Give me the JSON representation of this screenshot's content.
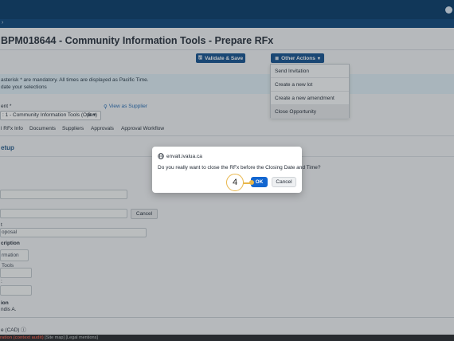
{
  "header": {
    "page_title": "BPM018644 - Community Information Tools - Prepare RFx"
  },
  "toolbar": {
    "validate_label": "Validate & Save",
    "other_actions_label": "Other Actions"
  },
  "actions_menu": {
    "items": [
      "Send Invitation",
      "Create a new lot",
      "Create a new amendment",
      "Close Opportunity"
    ],
    "highlighted": "Close Opportunity"
  },
  "banner": {
    "line1": "asterisk * are mandatory. All times are displayed as Pacific Time.",
    "line2": "date your selections"
  },
  "document": {
    "label": "ent *",
    "selected": ": 1 - Community Information Tools (Open)",
    "view_supplier": "View as Supplier"
  },
  "tabs": [
    "l RFx Info",
    "Documents",
    "Suppliers",
    "Approvals",
    "Approval Workflow"
  ],
  "section": {
    "title": "etup"
  },
  "form": {
    "cancel_label": "Cancel",
    "label_t": "t",
    "field_t_value": "oposal",
    "label_description": "cription",
    "field_description_value": "rmation Tools",
    "label_colon": ":",
    "label_ion": "ion",
    "value_ion": "ndis A.",
    "label_cad": "e (CAD) ⓘ"
  },
  "footer": {
    "audit": "ration (context audit)",
    "links": "[Site map] [Legal mentions]"
  },
  "dialog": {
    "origin": "envalt.ivalua.ca",
    "message": "Do you really want to close the RFx before the Closing Date and Time?",
    "ok_label": "OK",
    "cancel_label": "Cancel"
  },
  "step_marker": {
    "number": "4"
  }
}
